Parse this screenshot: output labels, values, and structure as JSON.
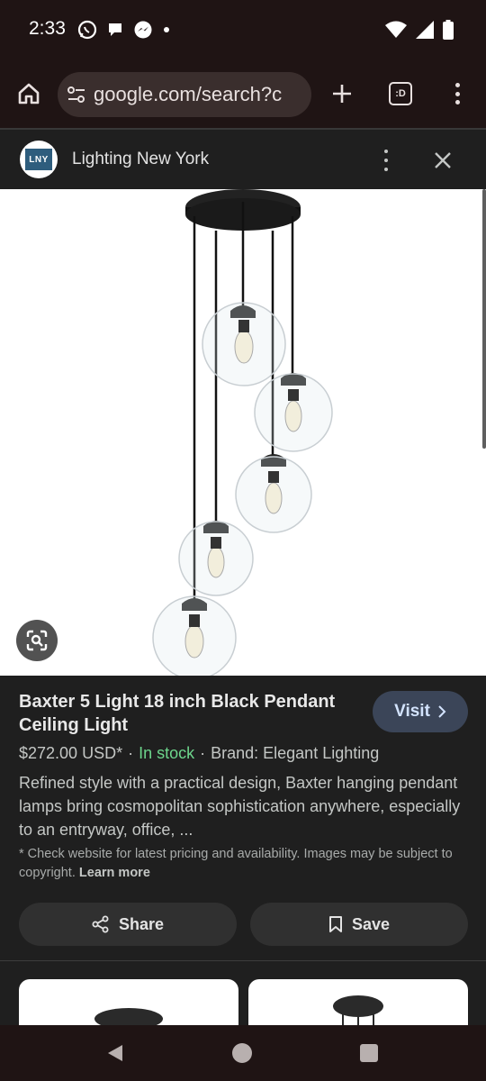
{
  "status_bar": {
    "time": "2:33",
    "left_icons": [
      "whatsapp-icon",
      "chat-bubble-icon",
      "messenger-icon",
      "dot-icon"
    ],
    "right_icons": [
      "wifi-icon",
      "signal-icon",
      "battery-icon"
    ]
  },
  "browser": {
    "url": "google.com/search?c",
    "tab_count": ":D"
  },
  "panel": {
    "site_logo_text": "LNY",
    "site_name": "Lighting New York"
  },
  "product": {
    "title": "Baxter 5 Light 18 inch Black Pendant Ceiling Light",
    "visit_label": "Visit",
    "price": "$272.00 USD*",
    "availability": "In stock",
    "brand": "Brand: Elegant Lighting",
    "separator": "·",
    "description": "Refined style with a practical design, Baxter hanging pendant lamps bring cosmopolitan sophistication anywhere, especially to an entryway, office, ...",
    "disclaimer": "* Check website for latest pricing and availability. Images may be subject to copyright.",
    "learn_more": "Learn more",
    "share_label": "Share",
    "save_label": "Save"
  },
  "colors": {
    "accent_stock": "#6dd58c",
    "visit_bg": "#3b4558",
    "visit_text": "#d3e3fd"
  }
}
